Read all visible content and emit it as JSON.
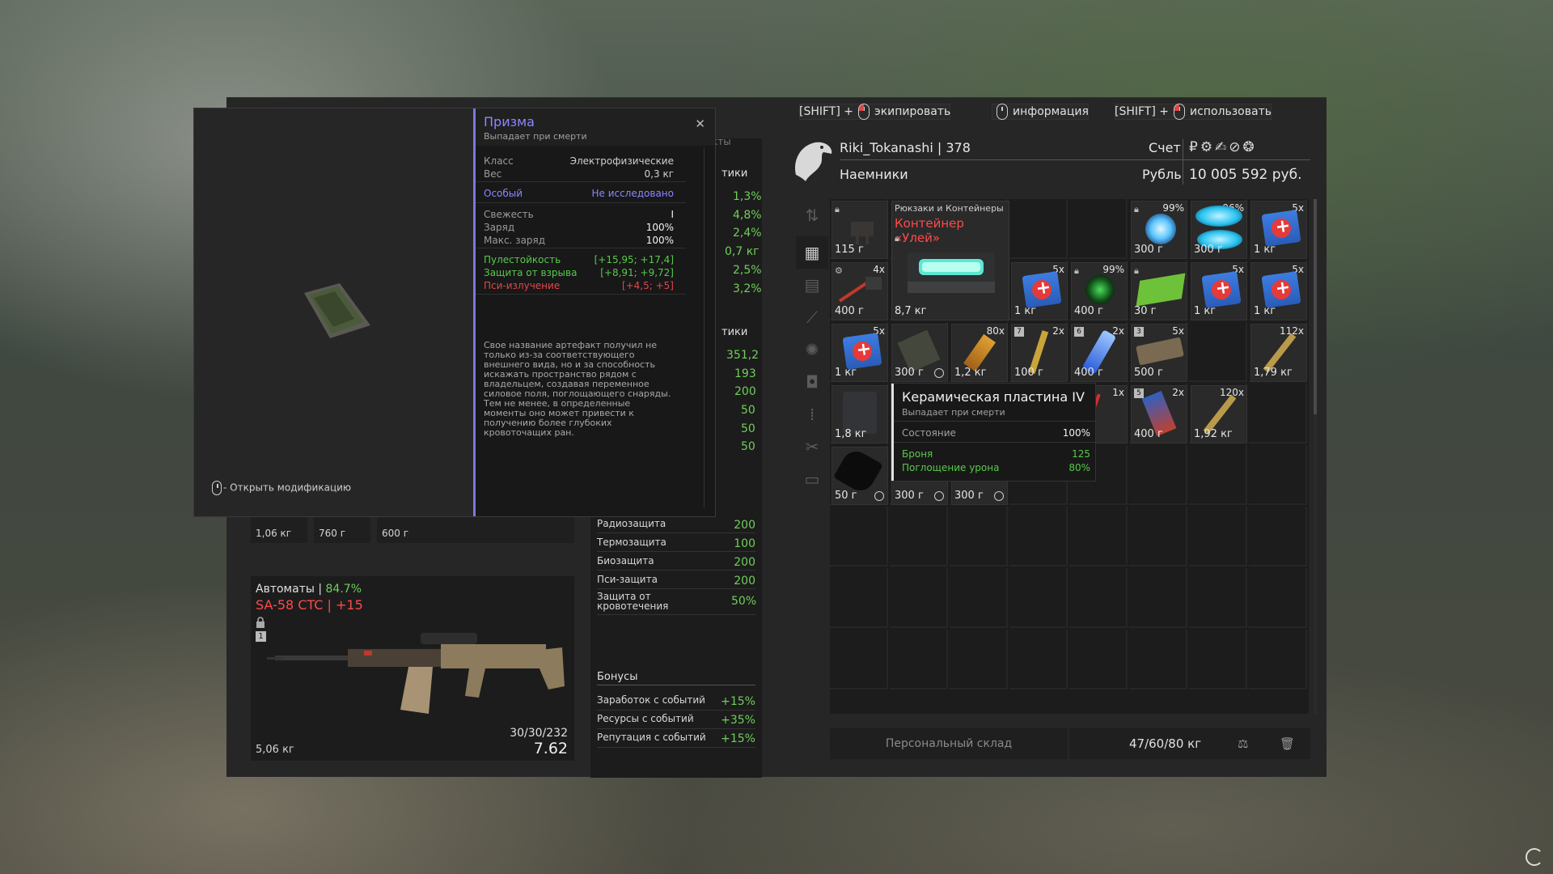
{
  "hints": {
    "equip_prefix": "[SHIFT] +",
    "equip": "экипировать",
    "info": "информация",
    "use_prefix": "[SHIFT] +",
    "use": "использовать"
  },
  "profile": {
    "name_level": "Riki_Tokanashi | 378",
    "faction": "Наемники",
    "account_label": "Счет",
    "currency_label": "Рубль",
    "money": "10 005 592 руб.",
    "currency_icons": "₽⚙✍⊘❂"
  },
  "artifact": {
    "title": "Призма",
    "subtitle": "Выпадает при смерти",
    "class_label": "Класс",
    "class_value": "Электрофизические",
    "weight_label": "Вес",
    "weight_value": "0,3 кг",
    "special_label": "Особый",
    "special_value": "Не исследовано",
    "freshness_label": "Свежесть",
    "freshness_value": "I",
    "charge_label": "Заряд",
    "charge_value": "100%",
    "max_charge_label": "Макс. заряд",
    "max_charge_value": "100%",
    "stat1_label": "Пулестойкость",
    "stat1_value": "[+15,95; +17,4]",
    "stat2_label": "Защита от взрыва",
    "stat2_value": "[+8,91; +9,72]",
    "stat3_label": "Пси-излучение",
    "stat3_value": "[+4,5; +5]",
    "description": "Свое название артефакт получил не только из-за соответствующего внешнего вида, но и за способность искажать пространство рядом с владельцем, создавая переменное силовое поля, поглощающего снаряды. Тем не менее, в определенные моменты оно может привести к получению более глубоких кровоточащих ран.",
    "open_mod_hint": "- Открыть модификацию"
  },
  "stats_partial": {
    "section1_frag": "тики",
    "section2_frag": "тики",
    "tab_frag": "кты",
    "values1": [
      "1,3%",
      "4,8%",
      "2,4%",
      "0,7 кг",
      "2,5%",
      "3,2%"
    ],
    "values2": [
      "351,2",
      "193",
      "200",
      "50",
      "50",
      "50"
    ]
  },
  "protection": [
    {
      "label": "Радиозащита",
      "value": "200"
    },
    {
      "label": "Термозащита",
      "value": "100"
    },
    {
      "label": "Биозащита",
      "value": "200"
    },
    {
      "label": "Пси-защита",
      "value": "200"
    },
    {
      "label": "Защита от кровотечения",
      "value": "50%"
    }
  ],
  "bonuses": {
    "title": "Бонусы",
    "items": [
      {
        "label": "Заработок с событий",
        "value": "+15%"
      },
      {
        "label": "Ресурсы с событий",
        "value": "+35%"
      },
      {
        "label": "Репутация с событий",
        "value": "+15%"
      }
    ]
  },
  "thumbs": [
    "1,06 кг",
    "760 г",
    "600 г"
  ],
  "weapon": {
    "category": "Автоматы | ",
    "condition": "84.7%",
    "name": "SA-58 CTC | +15",
    "slot": "1",
    "weight": "5,06 кг",
    "ammo": "30/30/232",
    "caliber": "7.62"
  },
  "container": {
    "category": "Рюкзаки и Контейнеры",
    "name": "Контейнер «Улей»",
    "weight": "8,7 кг"
  },
  "inventory": {
    "r1": [
      {
        "w": "115 г"
      },
      {
        "w": "300 г",
        "q": "99%"
      },
      {
        "w": "300 г",
        "q": "96%"
      },
      {
        "w": "1 кг",
        "q": "5x"
      }
    ],
    "r2": [
      {
        "w": "400 г",
        "q": "4x"
      },
      {
        "w": "1 кг",
        "q": "5x"
      },
      {
        "w": "400 г",
        "q": "99%"
      },
      {
        "w": "30 г"
      },
      {
        "w": "1 кг",
        "q": "5x"
      },
      {
        "w": "1 кг",
        "q": "5x"
      }
    ],
    "r3": [
      {
        "w": "1 кг",
        "q": "5x"
      },
      {
        "w": "300 г"
      },
      {
        "w": "1,2 кг",
        "q": "80x"
      },
      {
        "w": "100 г",
        "q": "2x",
        "n": "7"
      },
      {
        "w": "400 г",
        "q": "2x",
        "n": "6"
      },
      {
        "w": "500 г",
        "q": "5x",
        "n": "3"
      },
      {
        "w": "1,79 кг",
        "q": "112x"
      }
    ],
    "r4": [
      {
        "w": "1,8 кг"
      },
      {
        "q": "1x"
      },
      {
        "w": "400 г",
        "q": "2x",
        "n": "5"
      },
      {
        "w": "1,92 кг",
        "q": "120x"
      }
    ],
    "r5": [
      {
        "w": "50 г"
      },
      {
        "w": "300 г"
      },
      {
        "w": "300 г"
      }
    ]
  },
  "plate_tooltip": {
    "title": "Керамическая пластина IV",
    "subtitle": "Выпадает при смерти",
    "state_label": "Состояние",
    "state_value": "100%",
    "armor_label": "Броня",
    "armor_value": "125",
    "absorb_label": "Поглощение урона",
    "absorb_value": "80%"
  },
  "bottom": {
    "stash": "Персональный склад",
    "weight": "47/60/80 кг"
  },
  "colors": {
    "accent_purple": "#8c86ff",
    "positive_green": "#58c94b",
    "negative_red": "#e0484b",
    "weapon_red": "#ff4a4a"
  }
}
